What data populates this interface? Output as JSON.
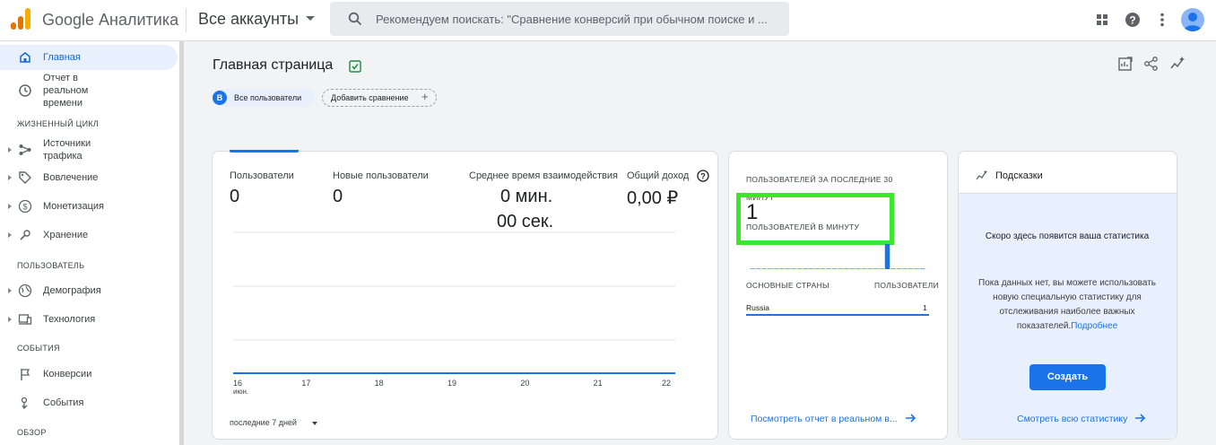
{
  "header": {
    "product_name": "Google Аналитика",
    "account_label": "Все аккаунты",
    "search_placeholder": "Рекомендуем поискать: \"Сравнение конверсий при обычном поиске и ...",
    "logo_colors": [
      "#f9ab00",
      "#e37400",
      "#e37400"
    ]
  },
  "sidebar": {
    "home": "Главная",
    "realtime": "Отчет в реальном времени",
    "section_lifecycle": "ЖИЗНЕННЫЙ ЦИКЛ",
    "acquisition": "Источники трафика",
    "engagement": "Вовлечение",
    "monetization": "Монетизация",
    "retention": "Хранение",
    "section_user": "ПОЛЬЗОВАТЕЛЬ",
    "demographics": "Демография",
    "tech": "Технология",
    "section_events": "СОБЫТИЯ",
    "conversions": "Конверсии",
    "events": "События",
    "section_overview": "ОБЗОР"
  },
  "main": {
    "title": "Главная страница",
    "chip_badge": "B",
    "chip_users": "Все пользователи",
    "chip_add": "Добавить сравнение",
    "chip_plus": "+"
  },
  "overview_card": {
    "metrics": [
      {
        "label": "Пользователи",
        "value": "0"
      },
      {
        "label": "Новые пользователи",
        "value": "0"
      },
      {
        "label": "Среднее время взаимодействия",
        "value_line1": "0 мин.",
        "value_line2": "00 сек."
      },
      {
        "label": "Общий доход",
        "value": "0,00 ₽"
      }
    ],
    "x_ticks": [
      "16",
      "17",
      "18",
      "19",
      "20",
      "21",
      "22"
    ],
    "x_month": "июн.",
    "range_label": "последние 7 дней"
  },
  "realtime_card": {
    "label_line1": "ПОЛЬЗОВАТЕЛЕЙ ЗА ПОСЛЕДНИЕ 30",
    "label_line2": "МИНУТ",
    "value": "1",
    "sub_label": "ПОЛЬЗОВАТЕЛЕЙ В МИНУТУ",
    "table_header_country": "ОСНОВНЫЕ СТРАНЫ",
    "table_header_users": "ПОЛЬЗОВАТЕЛИ",
    "rows": [
      {
        "country": "Russia",
        "users": "1"
      }
    ],
    "link": "Посмотреть отчет в реальном в..."
  },
  "insights_card": {
    "title": "Подсказки",
    "heading": "Скоро здесь появится ваша статистика",
    "body": "Пока данных нет, вы можете использовать новую специальную статистику для отслеживания наиболее важных показателей.",
    "body_link": "Подробнее",
    "button": "Создать",
    "link": "Смотреть всю статистику"
  },
  "colors": {
    "accent": "#1a73e8",
    "highlight": "#39e82c"
  }
}
